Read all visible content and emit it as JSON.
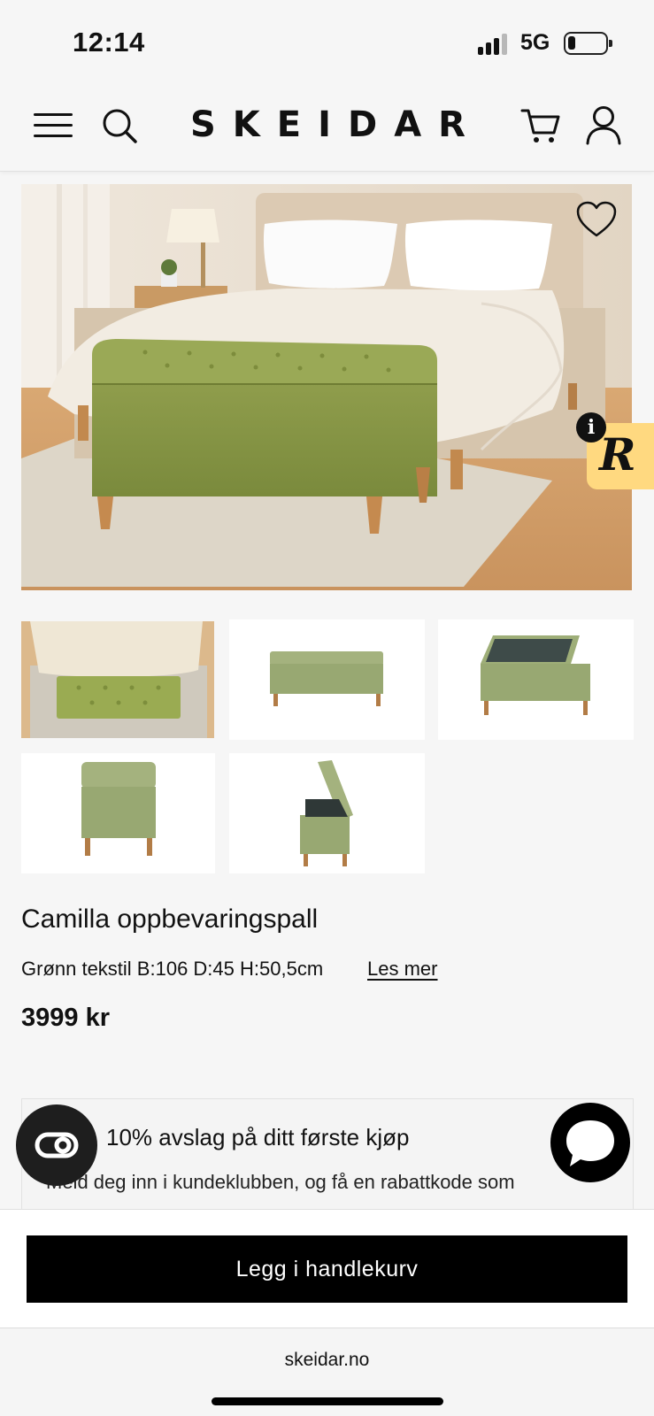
{
  "status_bar": {
    "time": "12:14",
    "network": "5G"
  },
  "header": {
    "logo": "SKEIDAR",
    "menu_icon": "hamburger-menu-icon",
    "search_icon": "search-icon",
    "cart_icon": "shopping-cart-icon",
    "account_icon": "user-icon"
  },
  "gallery": {
    "hero_alt": "Green upholstered storage bench at the foot of a bed",
    "favorite_icon": "heart-icon",
    "thumbnails": [
      {
        "view": "bench-at-bed-top-view"
      },
      {
        "view": "bench-front-closed"
      },
      {
        "view": "bench-open-lid"
      },
      {
        "view": "bench-side-closed"
      },
      {
        "view": "bench-side-open"
      }
    ]
  },
  "badge": {
    "letter": "R",
    "info": "i"
  },
  "product": {
    "title": "Camilla oppbevaringspall",
    "description": "Grønn tekstil B:106 D:45 H:50,5cm",
    "read_more": "Les mer",
    "price": "3999 kr"
  },
  "promo": {
    "title": "10% avslag på ditt første kjøp",
    "text": "Meld deg inn i kundeklubben, og få en rabattkode som"
  },
  "cta": {
    "add_to_cart": "Legg i handlekurv"
  },
  "browser": {
    "url": "skeidar.no"
  },
  "colors": {
    "bench_green": "#8c9a4a",
    "badge_yellow": "#ffd980",
    "cta_black": "#000000"
  }
}
